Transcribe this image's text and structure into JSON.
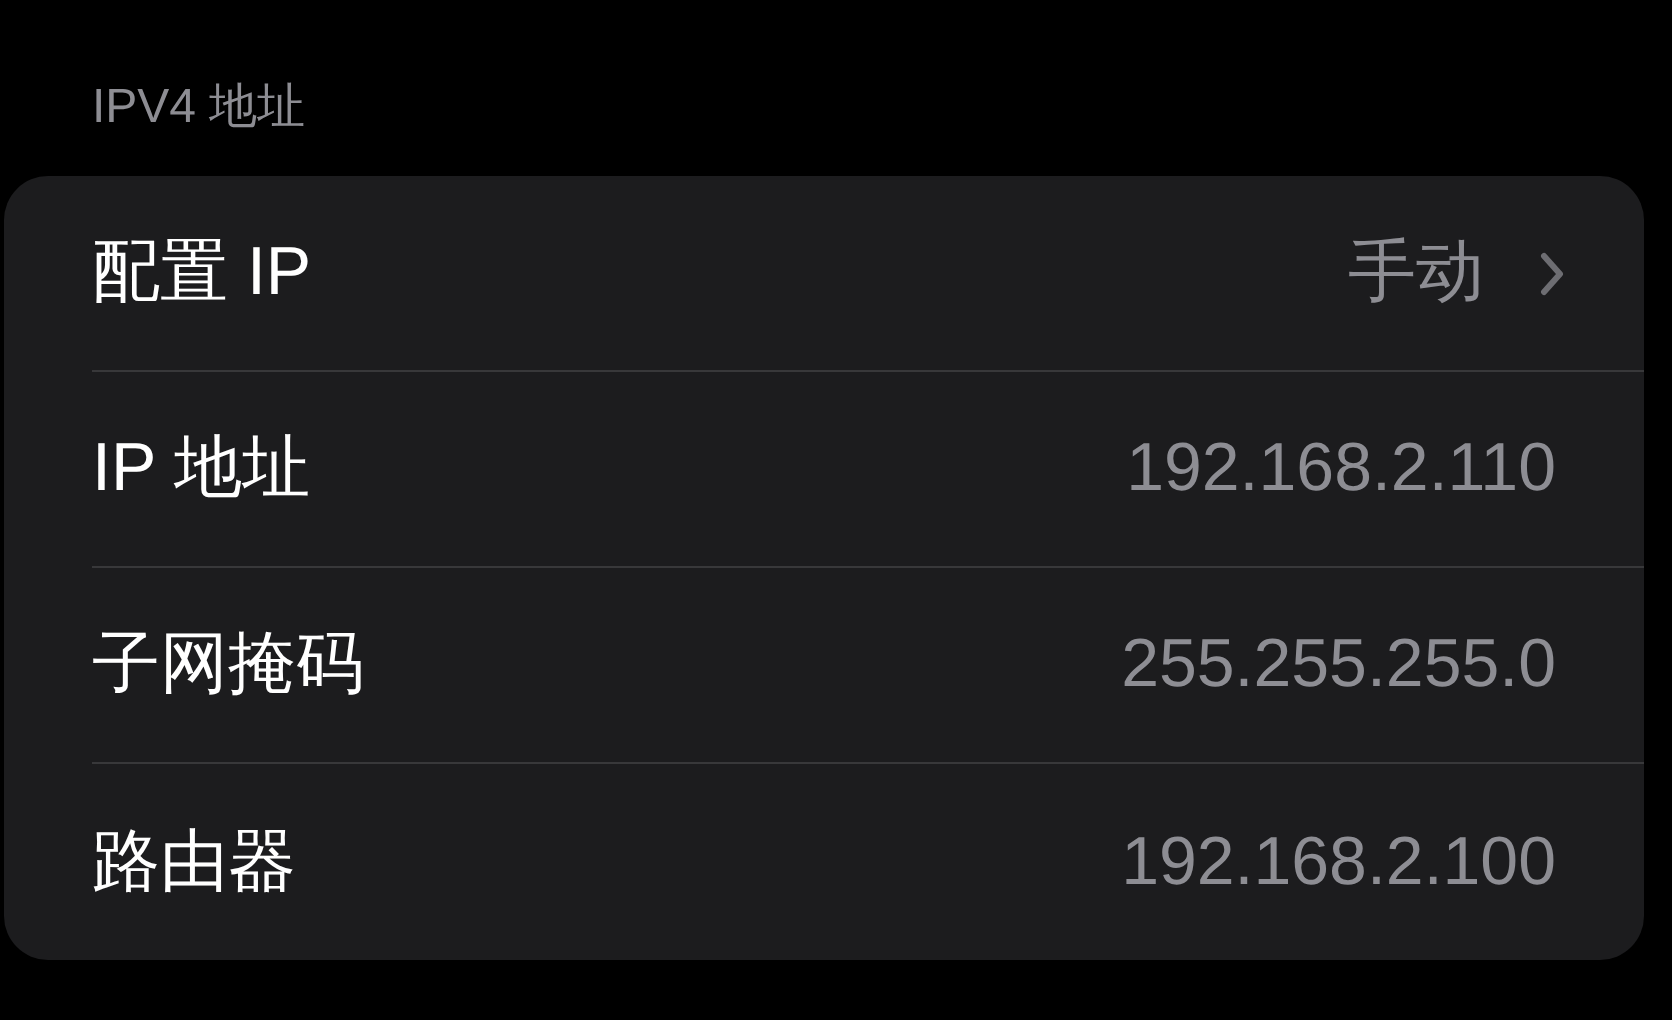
{
  "section_header": "IPV4 地址",
  "rows": [
    {
      "label": "配置 IP",
      "value": "手动",
      "kind": "disclosure"
    },
    {
      "label": "IP 地址",
      "value": "192.168.2.110",
      "kind": "value"
    },
    {
      "label": "子网掩码",
      "value": "255.255.255.0",
      "kind": "value"
    },
    {
      "label": "路由器",
      "value": "192.168.2.100",
      "kind": "value"
    }
  ]
}
